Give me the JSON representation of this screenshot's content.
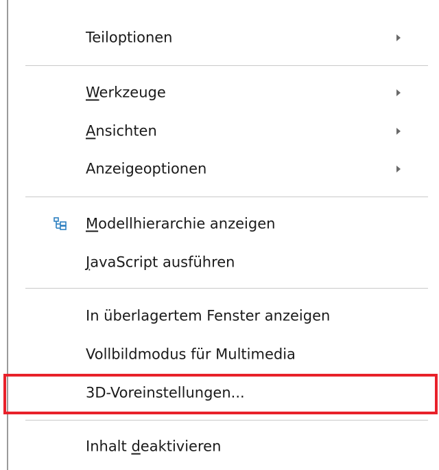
{
  "menu": {
    "items": [
      {
        "label": "Teiloptionen",
        "submenu": true
      },
      {
        "label_pre": "",
        "mnemonic": "W",
        "label_post": "erkzeuge",
        "submenu": true
      },
      {
        "label_pre": "",
        "mnemonic": "A",
        "label_post": "nsichten",
        "submenu": true
      },
      {
        "label": "Anzeigeoptionen",
        "submenu": true
      },
      {
        "label_pre": "",
        "mnemonic": "M",
        "label_post": "odellhierarchie anzeigen",
        "icon": "model-tree-icon"
      },
      {
        "label_pre": "",
        "mnemonic": "J",
        "label_post": "avaScript ausführen"
      },
      {
        "label": "In überlagertem Fenster anzeigen"
      },
      {
        "label": "Vollbildmodus für Multimedia"
      },
      {
        "label": "3D-Voreinstellungen...",
        "highlighted": true
      },
      {
        "label_pre": "Inhalt ",
        "mnemonic": "d",
        "label_post": "eaktivieren"
      }
    ]
  },
  "colors": {
    "highlight_border": "#e8212a",
    "icon_blue": "#2b7fc0",
    "separator": "#c8c8c8"
  }
}
